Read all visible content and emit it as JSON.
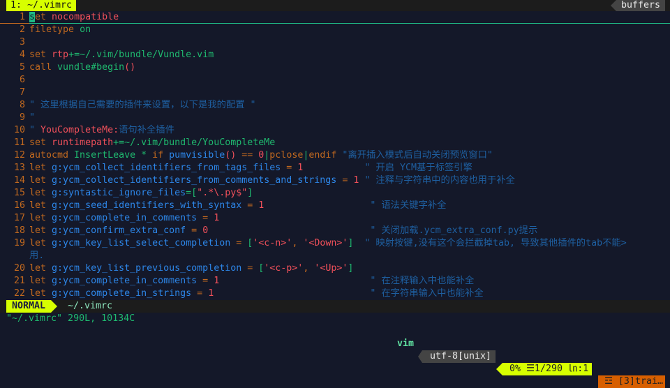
{
  "tabline": {
    "active_tab": "1: ~/.vimrc",
    "buffers_label": "buffers"
  },
  "colors": {
    "background": "#141829",
    "mode_bg": "#d7ff00",
    "warning_bg": "#d75f00",
    "cursor": "#1fb985"
  },
  "lines": [
    {
      "n": "1",
      "t": [
        [
          "k",
          "set"
        ],
        [
          "o",
          " "
        ],
        [
          "r",
          "nocompatible"
        ]
      ]
    },
    {
      "n": "2",
      "t": [
        [
          "k",
          "filetype "
        ],
        [
          "g",
          "on"
        ]
      ]
    },
    {
      "n": "3",
      "t": []
    },
    {
      "n": "4",
      "t": [
        [
          "k",
          "set "
        ],
        [
          "r",
          "rtp"
        ],
        [
          "g",
          "+=~/.vim/bundle/Vundle.vim"
        ]
      ]
    },
    {
      "n": "5",
      "t": [
        [
          "k",
          "call "
        ],
        [
          "g",
          "vundle#begin"
        ],
        [
          "r",
          "()"
        ]
      ]
    },
    {
      "n": "6",
      "t": []
    },
    {
      "n": "7",
      "t": []
    },
    {
      "n": "8",
      "t": [
        [
          "c",
          "\" 这里根据自己需要的插件来设置，以下是我的配置 \""
        ]
      ]
    },
    {
      "n": "9",
      "t": [
        [
          "c",
          "\""
        ]
      ]
    },
    {
      "n": "10",
      "t": [
        [
          "c",
          "\" "
        ],
        [
          "r",
          "YouCompleteMe:"
        ],
        [
          "c",
          "语句补全插件"
        ]
      ]
    },
    {
      "n": "11",
      "t": [
        [
          "k",
          "set "
        ],
        [
          "r",
          "runtimepath"
        ],
        [
          "g",
          "+=~/.vim/bundle/YouCompleteMe"
        ]
      ]
    },
    {
      "n": "12",
      "t": [
        [
          "k",
          "autocmd "
        ],
        [
          "g",
          "InsertLeave * "
        ],
        [
          "k",
          "if "
        ],
        [
          "b",
          "pumvisible"
        ],
        [
          "r",
          "()"
        ],
        [
          "o",
          " == "
        ],
        [
          "r",
          "0"
        ],
        [
          "g",
          "|"
        ],
        [
          "k",
          "pclose"
        ],
        [
          "g",
          "|"
        ],
        [
          "k",
          "endif "
        ],
        [
          "c",
          "\"离开插入模式后自动关闭预览窗口\""
        ]
      ]
    },
    {
      "n": "13",
      "t": [
        [
          "k",
          "let "
        ],
        [
          "b",
          "g:ycm_collect_identifiers_from_tags_files"
        ],
        [
          "o",
          " = "
        ],
        [
          "r",
          "1"
        ],
        [
          "c",
          "           \" 开启 YCM基于标签引擎"
        ]
      ]
    },
    {
      "n": "14",
      "t": [
        [
          "k",
          "let "
        ],
        [
          "b",
          "g:ycm_collect_identifiers_from_comments_and_strings"
        ],
        [
          "o",
          " = "
        ],
        [
          "r",
          "1"
        ],
        [
          "c",
          " \" 注释与字符串中的内容也用于补全"
        ]
      ]
    },
    {
      "n": "15",
      "t": [
        [
          "k",
          "let "
        ],
        [
          "b",
          "g:syntastic_ignore_files"
        ],
        [
          "g",
          "=["
        ],
        [
          "r",
          "\".*\\.py$\""
        ],
        [
          "g",
          "]"
        ]
      ]
    },
    {
      "n": "16",
      "t": [
        [
          "k",
          "let "
        ],
        [
          "b",
          "g:ycm_seed_identifiers_with_syntax"
        ],
        [
          "o",
          " = "
        ],
        [
          "r",
          "1"
        ],
        [
          "c",
          "                   \" 语法关键字补全"
        ]
      ]
    },
    {
      "n": "17",
      "t": [
        [
          "k",
          "let "
        ],
        [
          "b",
          "g:ycm_complete_in_comments"
        ],
        [
          "o",
          " = "
        ],
        [
          "r",
          "1"
        ]
      ]
    },
    {
      "n": "18",
      "t": [
        [
          "k",
          "let "
        ],
        [
          "b",
          "g:ycm_confirm_extra_conf"
        ],
        [
          "o",
          " = "
        ],
        [
          "r",
          "0"
        ],
        [
          "c",
          "                             \" 关闭加载.ycm_extra_conf.py提示"
        ]
      ]
    },
    {
      "n": "19",
      "t": [
        [
          "k",
          "let "
        ],
        [
          "b",
          "g:ycm_key_list_select_completion"
        ],
        [
          "o",
          " = "
        ],
        [
          "g",
          "["
        ],
        [
          "r",
          "'<c-n>'"
        ],
        [
          "o",
          ", "
        ],
        [
          "r",
          "'<Down>'"
        ],
        [
          "g",
          "]"
        ],
        [
          "c",
          "  \" 映射按键,没有这个会拦截掉tab, 导致其他插件的tab不能>"
        ]
      ]
    },
    {
      "n": "",
      "t": [
        [
          "c",
          "用."
        ]
      ]
    },
    {
      "n": "20",
      "t": [
        [
          "k",
          "let "
        ],
        [
          "b",
          "g:ycm_key_list_previous_completion"
        ],
        [
          "o",
          " = "
        ],
        [
          "g",
          "["
        ],
        [
          "r",
          "'<c-p>'"
        ],
        [
          "o",
          ", "
        ],
        [
          "r",
          "'<Up>'"
        ],
        [
          "g",
          "]"
        ]
      ]
    },
    {
      "n": "21",
      "t": [
        [
          "k",
          "let "
        ],
        [
          "b",
          "g:ycm_complete_in_comments"
        ],
        [
          "o",
          " = "
        ],
        [
          "r",
          "1"
        ],
        [
          "c",
          "                           \" 在注释输入中也能补全"
        ]
      ]
    },
    {
      "n": "22",
      "t": [
        [
          "k",
          "let "
        ],
        [
          "b",
          "g:ycm_complete_in_strings"
        ],
        [
          "o",
          " = "
        ],
        [
          "r",
          "1"
        ],
        [
          "c",
          "                            \" 在字符串输入中也能补全"
        ]
      ]
    }
  ],
  "statusline": {
    "mode": "NORMAL",
    "filename": "~/.vimrc",
    "filetype": "vim",
    "encoding": "utf-8[unix]",
    "position": "0% ☰1/290 ㏑:1",
    "warning": "☲ [3]trai…"
  },
  "cmdline": "\"~/.vimrc\" 290L, 10134C"
}
